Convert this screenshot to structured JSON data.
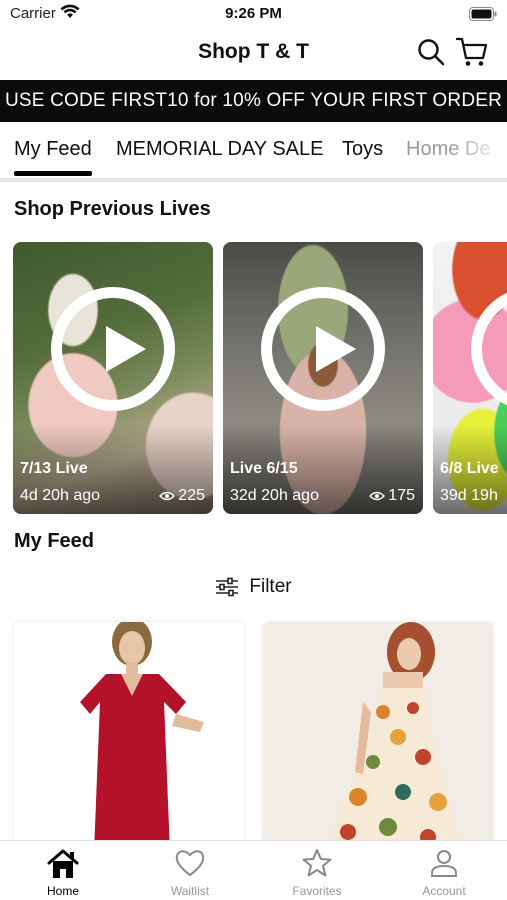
{
  "status_bar": {
    "carrier": "Carrier",
    "time": "9:26 PM"
  },
  "header": {
    "title": "Shop T & T"
  },
  "promo": {
    "text": "USE CODE FIRST10 for 10% OFF YOUR FIRST ORDER"
  },
  "tabs": [
    {
      "label": "My Feed",
      "active": true
    },
    {
      "label": "MEMORIAL DAY SALE",
      "active": false
    },
    {
      "label": "Toys",
      "active": false
    },
    {
      "label": "Home De",
      "active": false
    }
  ],
  "previous_lives": {
    "title": "Shop Previous Lives",
    "items": [
      {
        "label": "7/13 Live",
        "ago": "4d 20h ago",
        "views": "225"
      },
      {
        "label": "Live 6/15",
        "ago": "32d 20h ago",
        "views": "175"
      },
      {
        "label": "6/8 Live",
        "ago": "39d 19h",
        "views": ""
      }
    ]
  },
  "feed": {
    "title": "My Feed",
    "filter_label": "Filter"
  },
  "tab_bar": [
    {
      "label": "Home",
      "icon": "home-icon",
      "active": true
    },
    {
      "label": "Waitlist",
      "icon": "heart-icon",
      "active": false
    },
    {
      "label": "Favorites",
      "icon": "star-icon",
      "active": false
    },
    {
      "label": "Account",
      "icon": "person-icon",
      "active": false
    }
  ],
  "colors": {
    "banner_bg": "#0b0b0b",
    "active_tab": "#000000",
    "inactive_label": "#999999"
  }
}
